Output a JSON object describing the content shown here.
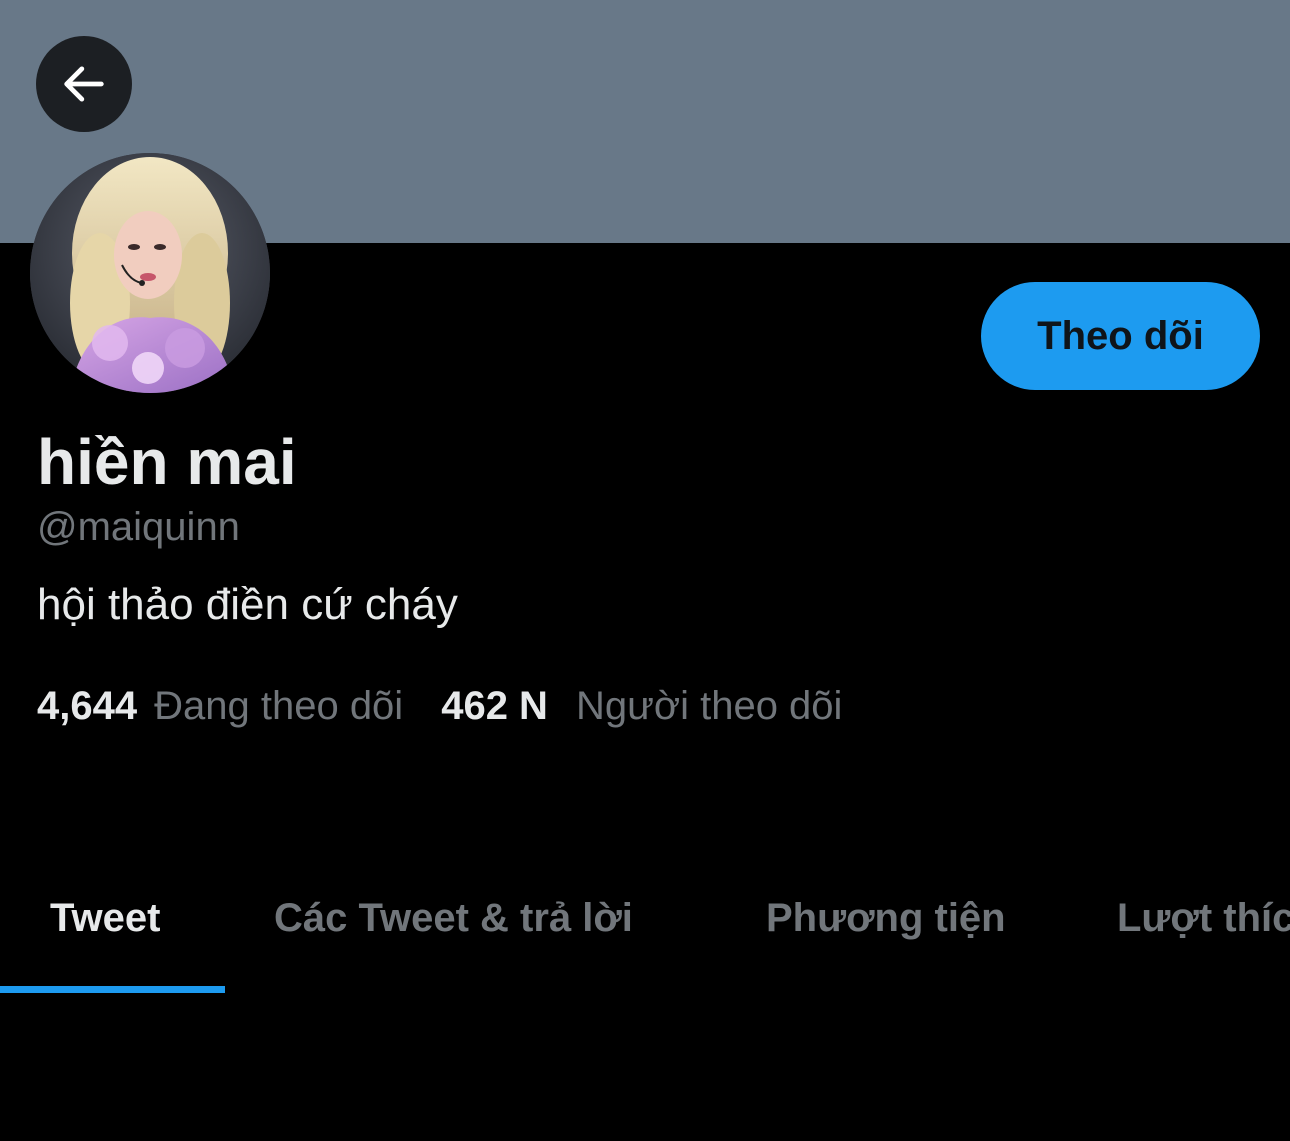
{
  "header": {
    "back_icon": "arrow-left-icon",
    "banner_color": "#687888"
  },
  "profile": {
    "display_name": "hiền mai",
    "handle": "@maiquinn",
    "bio": "hội thảo điền cứ cháy",
    "follow_button_label": "Theo dõi"
  },
  "stats": {
    "following_count": "4,644",
    "following_label": "Đang theo dõi",
    "followers_count": "462 N",
    "followers_label": "Người theo dõi"
  },
  "tabs": [
    {
      "label": "Tweet",
      "active": true
    },
    {
      "label": "Các Tweet & trả lời",
      "active": false
    },
    {
      "label": "Phương tiện",
      "active": false
    },
    {
      "label": "Lượt thích",
      "active": false
    }
  ],
  "colors": {
    "accent": "#1d9bf0",
    "background": "#000000",
    "primary_text": "#e7e9ea",
    "secondary_text": "#71767b"
  }
}
